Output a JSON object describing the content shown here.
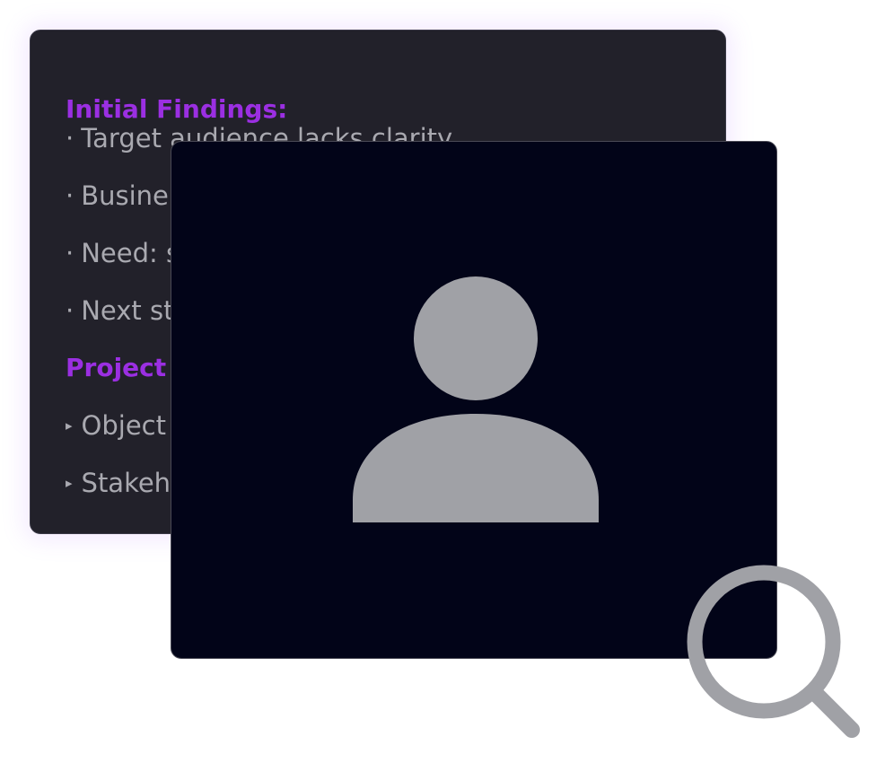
{
  "notes": {
    "heading_initial": "Initial Findings:",
    "bullet_dot": "·",
    "items": [
      "Target audience lacks clarity",
      "Busine",
      "Need: s",
      "Next st"
    ],
    "heading_project": "Project",
    "bullet_tri": "▸",
    "sub_items": [
      "Object",
      "Stakeh"
    ]
  },
  "colors": {
    "heading": "#9b2fe2",
    "text": "#a9a9b0",
    "notes_bg": "#22212a",
    "avatar_bg": "#020418",
    "icon": "#a0a1a6"
  },
  "icons": {
    "profile": "user-avatar-icon",
    "search": "search-icon"
  }
}
